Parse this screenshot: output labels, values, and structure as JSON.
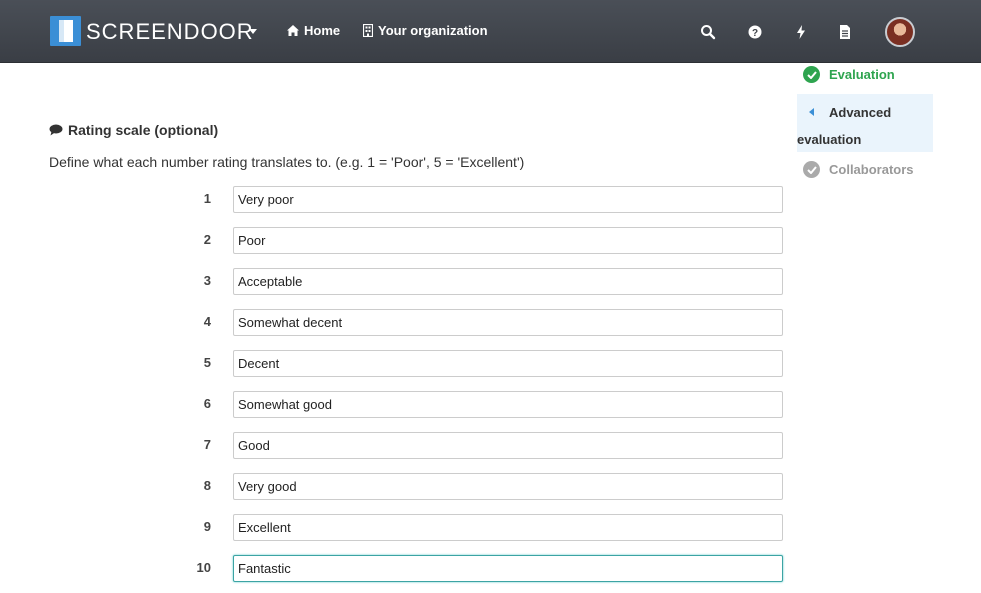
{
  "navbar": {
    "brand": "SCREENDOOR",
    "home_label": "Home",
    "org_label": "Your organization",
    "icons": [
      "search-icon",
      "help-icon",
      "bolt-icon",
      "document-icon"
    ]
  },
  "sidebar": {
    "items": [
      {
        "label": "Evaluation",
        "state": "complete"
      },
      {
        "label_line1": "Advanced",
        "label_line2": "evaluation",
        "state": "active"
      },
      {
        "label": "Collaborators",
        "state": "inactive"
      }
    ]
  },
  "section": {
    "title": "Rating scale (optional)",
    "description": "Define what each number rating translates to. (e.g. 1 = 'Poor', 5 = 'Excellent')"
  },
  "ratings": [
    {
      "num": "1",
      "value": "Very poor"
    },
    {
      "num": "2",
      "value": "Poor"
    },
    {
      "num": "3",
      "value": "Acceptable"
    },
    {
      "num": "4",
      "value": "Somewhat decent"
    },
    {
      "num": "5",
      "value": "Decent"
    },
    {
      "num": "6",
      "value": "Somewhat good"
    },
    {
      "num": "7",
      "value": "Good"
    },
    {
      "num": "8",
      "value": "Very good"
    },
    {
      "num": "9",
      "value": "Excellent"
    },
    {
      "num": "10",
      "value": "Fantastic"
    }
  ],
  "colors": {
    "navbar": "#3f434a",
    "accent_green": "#2ea44f",
    "brand_blue": "#3b8fd6",
    "active_bg": "#eaf4fc"
  }
}
